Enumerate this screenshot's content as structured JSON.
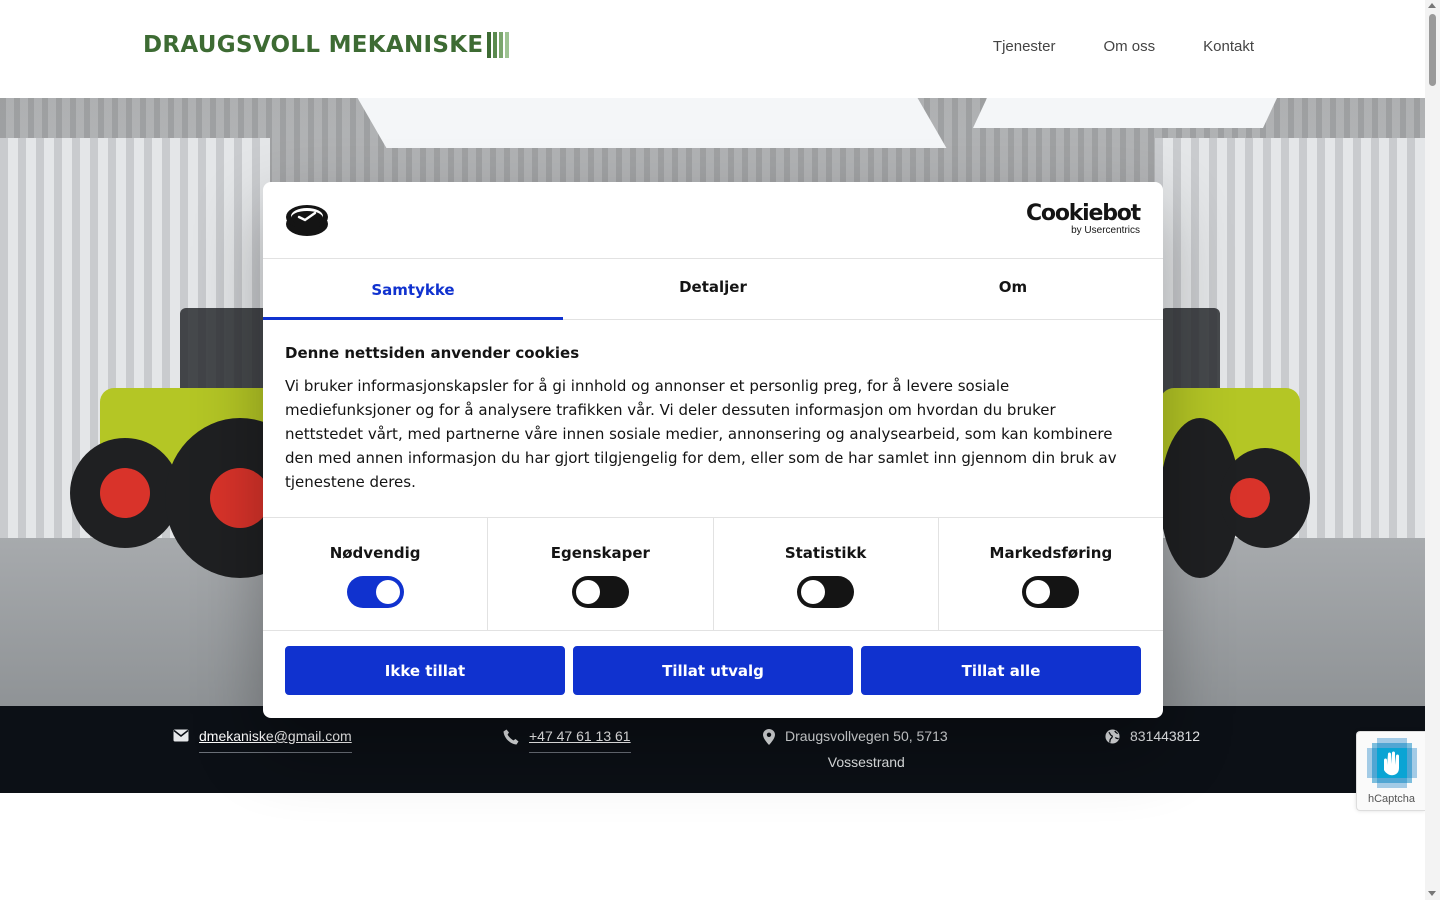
{
  "site": {
    "logo_text": "DRAUGSVOLL MEKANISKE",
    "nav": [
      "Tjenester",
      "Om oss",
      "Kontakt"
    ]
  },
  "hero": {
    "image": "tractors-in-garage"
  },
  "contact": {
    "email": "dmekaniske@gmail.com",
    "phone": "+47 47 61 13 61",
    "address_line1": "Draugsvollvegen 50, 5713",
    "address_line2": "Vossestrand",
    "org_number": "831443812"
  },
  "cookie_dialog": {
    "brand": "Cookiebot",
    "brand_sub": "by Usercentrics",
    "tabs": [
      "Samtykke",
      "Detaljer",
      "Om"
    ],
    "active_tab": "Samtykke",
    "title": "Denne nettsiden anvender cookies",
    "body": "Vi bruker informasjonskapsler for å gi innhold og annonser et personlig preg, for å levere sosiale mediefunksjoner og for å analysere trafikken vår. Vi deler dessuten informasjon om hvordan du bruker nettstedet vårt, med partnerne våre innen sosiale medier, annonsering og analysearbeid, som kan kombinere den med annen informasjon du har gjort tilgjengelig for dem, eller som de har samlet inn gjennom din bruk av tjenestene deres.",
    "toggles": [
      {
        "label": "Nødvendig",
        "on": true
      },
      {
        "label": "Egenskaper",
        "on": false
      },
      {
        "label": "Statistikk",
        "on": false
      },
      {
        "label": "Markedsføring",
        "on": false
      }
    ],
    "buttons": [
      "Ikke tillat",
      "Tillat utvalg",
      "Tillat alle"
    ]
  },
  "captcha": {
    "label": "hCaptcha"
  },
  "colors": {
    "accent_blue": "#1032cf",
    "logo_green": "#3d6b33",
    "footer_bg": "#0c1016"
  }
}
